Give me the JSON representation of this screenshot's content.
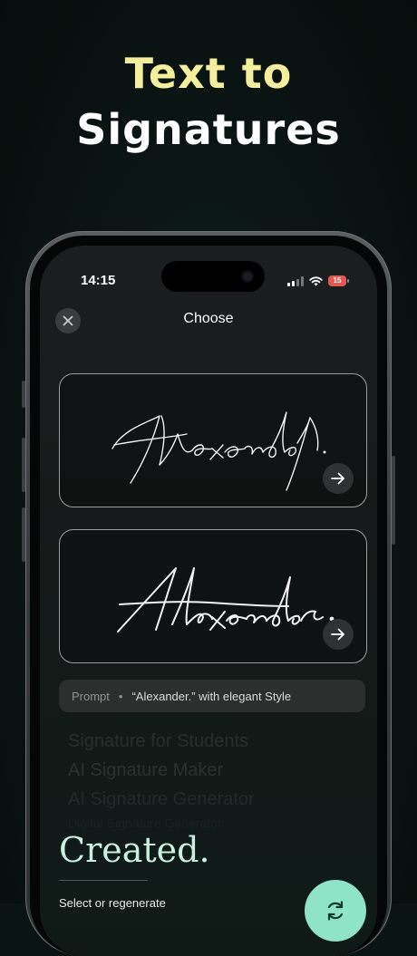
{
  "headline": {
    "accent": "Text to",
    "main": "Signatures"
  },
  "status_bar": {
    "time": "14:15",
    "battery": "15"
  },
  "nav": {
    "title": "Choose"
  },
  "cards": [
    {
      "signature": "Alexandel."
    },
    {
      "signature": "Alexander."
    }
  ],
  "prompt": {
    "label": "Prompt",
    "separator": "•",
    "text": "“Alexander.” with elegant Style"
  },
  "faded_list": [
    "Signature for Students",
    "AI Signature Maker",
    "AI Signature Generator",
    "Digital Signature Generator"
  ],
  "footer": {
    "created": "Created.",
    "select_text": "Select or regenerate"
  },
  "colors": {
    "accent_yellow": "#f4ef9c",
    "mint": "#8fe3c6",
    "battery_red": "#e05a52"
  },
  "icons": [
    "close-icon",
    "arrow-right-icon",
    "regenerate-icon",
    "wifi-icon",
    "signal-icon"
  ]
}
